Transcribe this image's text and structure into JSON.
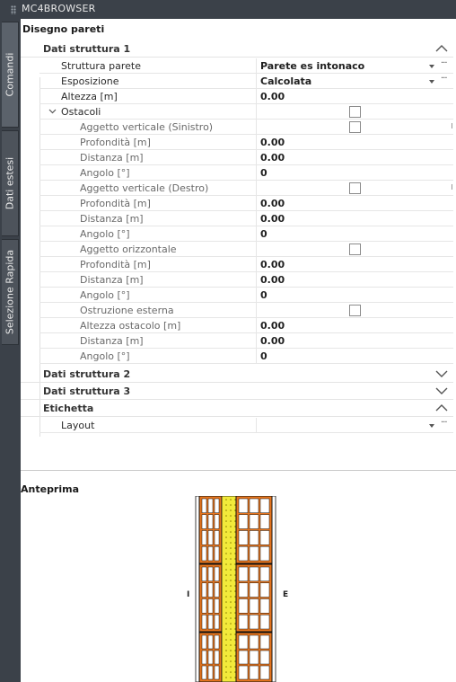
{
  "window": {
    "title": "MC4BROWSER"
  },
  "tabs": [
    {
      "label": "Comandi"
    },
    {
      "label": "Dati estesi"
    },
    {
      "label": "Selezione Rapida"
    }
  ],
  "panel": {
    "title": "Disegno pareti"
  },
  "sections": {
    "s1": {
      "label": "Dati struttura 1",
      "expanded": true
    },
    "s2": {
      "label": "Dati struttura 2",
      "expanded": false
    },
    "s3": {
      "label": "Dati struttura 3",
      "expanded": false
    },
    "s4": {
      "label": "Etichetta",
      "expanded": true
    }
  },
  "props": {
    "struttura": {
      "name": "Struttura parete",
      "value": "Parete es intonaco"
    },
    "esposizione": {
      "name": "Esposizione",
      "value": "Calcolata"
    },
    "altezza": {
      "name": "Altezza [m]",
      "value": "0.00"
    },
    "ostacoli": {
      "name": "Ostacoli"
    },
    "avs": {
      "name": "Aggetto verticale (Sinistro)",
      "checked": false
    },
    "avs_prof": {
      "name": "Profondità [m]",
      "value": "0.00"
    },
    "avs_dist": {
      "name": "Distanza [m]",
      "value": "0.00"
    },
    "avs_ang": {
      "name": "Angolo [°]",
      "value": "0"
    },
    "avd": {
      "name": "Aggetto verticale (Destro)",
      "checked": false
    },
    "avd_prof": {
      "name": "Profondità [m]",
      "value": "0.00"
    },
    "avd_dist": {
      "name": "Distanza [m]",
      "value": "0.00"
    },
    "avd_ang": {
      "name": "Angolo [°]",
      "value": "0"
    },
    "ao": {
      "name": "Aggetto orizzontale",
      "checked": false
    },
    "ao_prof": {
      "name": "Profondità [m]",
      "value": "0.00"
    },
    "ao_dist": {
      "name": "Distanza [m]",
      "value": "0.00"
    },
    "ao_ang": {
      "name": "Angolo [°]",
      "value": "0"
    },
    "oe": {
      "name": "Ostruzione esterna",
      "checked": false
    },
    "oe_alt": {
      "name": "Altezza ostacolo [m]",
      "value": "0.00"
    },
    "oe_dist": {
      "name": "Distanza [m]",
      "value": "0.00"
    },
    "oe_ang": {
      "name": "Angolo [°]",
      "value": "0"
    },
    "layout": {
      "name": "Layout",
      "value": ""
    }
  },
  "preview": {
    "title": "Anteprima",
    "label_inner": "I",
    "label_outer": "E",
    "colors": {
      "brick": "#e8761e",
      "insulation": "#f2ea3a",
      "plaster": "#ffffff",
      "outline": "#111111"
    }
  }
}
